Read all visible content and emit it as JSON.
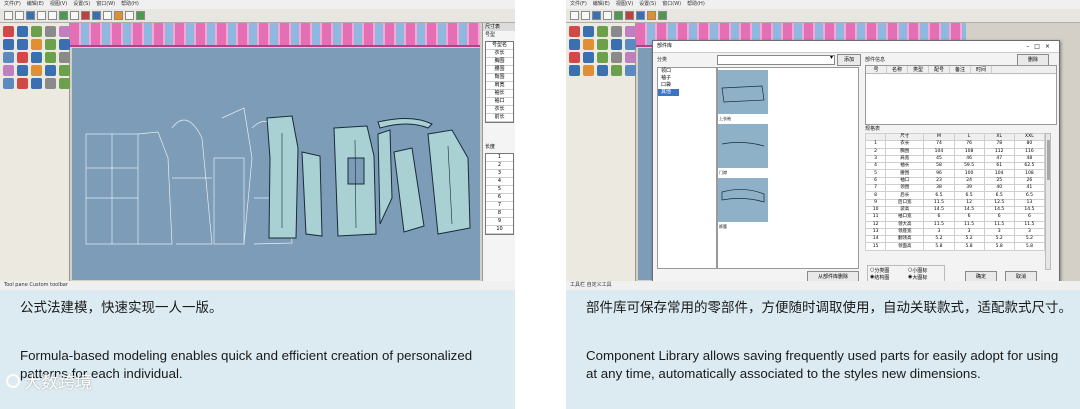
{
  "left": {
    "app": {
      "menu": [
        "文件(F)",
        "编辑(E)",
        "视图(V)",
        "设置(S)",
        "窗口(W)",
        "帮助(H)"
      ],
      "right_pane_title": "尺寸表",
      "right_pane_label": "号型",
      "size_list": [
        "号型名",
        "衣长",
        "胸围",
        "腰围",
        "臀围",
        "肩宽",
        "袖长",
        "袖口",
        "衣长",
        "前长"
      ],
      "list_label": "长度",
      "list_rows": [
        "1",
        "2",
        "3",
        "4",
        "5",
        "6",
        "7",
        "8",
        "9",
        "10"
      ],
      "statusbar": "Tool pane  Custom toolbar"
    },
    "caption_zh": "公式法建模，快速实现一人一版。",
    "caption_en": "Formula-based modeling enables quick and efficient creation of personalized patterns for each individual."
  },
  "right": {
    "dialog": {
      "title": "部件库",
      "category_label": "分类",
      "add_button": "添加",
      "tree": [
        "领口",
        "袖子",
        "口袋",
        "其他"
      ],
      "selected_tree_item": "其他",
      "thumb_captions": [
        "上衣袖",
        "门襟",
        "裤腰"
      ],
      "part_info_label": "部件信息",
      "delete_button": "删除",
      "part_info_headers": [
        "号",
        "名称",
        "类型",
        "配号",
        "备注",
        "时间"
      ],
      "size_table_label": "规格表",
      "size_headers": [
        "",
        "尺寸",
        "M",
        "L",
        "XL",
        "XXL"
      ],
      "size_rows": [
        [
          "1",
          "衣长",
          "74",
          "76",
          "78",
          "80"
        ],
        [
          "2",
          "胸围",
          "104",
          "108",
          "112",
          "116"
        ],
        [
          "3",
          "肩宽",
          "45",
          "46",
          "47",
          "48"
        ],
        [
          "4",
          "袖长",
          "58",
          "59.5",
          "61",
          "62.5"
        ],
        [
          "5",
          "腰围",
          "96",
          "100",
          "104",
          "108"
        ],
        [
          "6",
          "袖口",
          "23",
          "24",
          "25",
          "26"
        ],
        [
          "7",
          "领围",
          "38",
          "39",
          "40",
          "41"
        ],
        [
          "8",
          "后长",
          "6.5",
          "6.5",
          "6.5",
          "6.5"
        ],
        [
          "9",
          "后口宽",
          "11.5",
          "12",
          "12.5",
          "13"
        ],
        [
          "10",
          "袋高",
          "14.5",
          "14.5",
          "14.5",
          "14.5"
        ],
        [
          "11",
          "袖口宽",
          "6",
          "6",
          "6",
          "6"
        ],
        [
          "12",
          "领大高",
          "11.5",
          "11.5",
          "11.5",
          "11.5"
        ],
        [
          "13",
          "领座宽",
          "3",
          "3",
          "3",
          "3"
        ],
        [
          "14",
          "翻领高",
          "5.2",
          "5.2",
          "5.2",
          "5.2"
        ],
        [
          "15",
          "领面高",
          "5.8",
          "5.8",
          "5.8",
          "5.8"
        ]
      ],
      "radio_small": "小图标",
      "radio_large": "大图标",
      "radio_a": "分类图",
      "radio_b": "结构图",
      "delete_from_library": "从部件库删除",
      "ok_button": "确定",
      "cancel_button": "取消"
    },
    "statusbar": "工具栏  自定义工具",
    "caption_zh": "部件库可保存常用的零部件，方便随时调取使用，自动关联款式，适配款式尺寸。",
    "caption_en": "Component Library allows saving frequently used parts for easily adopt for using at any time, automatically associated to the styles new dimensions."
  },
  "watermark": "大数跨境"
}
